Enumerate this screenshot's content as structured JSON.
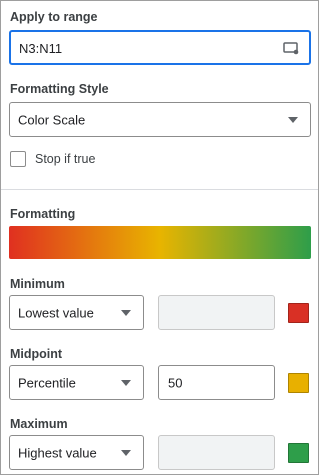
{
  "apply_range": {
    "label": "Apply to range",
    "value": "N3:N11",
    "icon": "select-range-icon"
  },
  "formatting_style": {
    "label": "Formatting Style",
    "selected": "Color Scale"
  },
  "stop_if_true": {
    "label": "Stop if true",
    "checked": false
  },
  "formatting": {
    "label": "Formatting",
    "gradient_colors": [
      "#e03020",
      "#e8b400",
      "#2e9e4a"
    ]
  },
  "minimum": {
    "label": "Minimum",
    "type": "Lowest value",
    "value": "",
    "color": "#d93025"
  },
  "midpoint": {
    "label": "Midpoint",
    "type": "Percentile",
    "value": "50",
    "color": "#e8b000"
  },
  "maximum": {
    "label": "Maximum",
    "type": "Highest value",
    "value": "",
    "color": "#2e9e4a"
  }
}
